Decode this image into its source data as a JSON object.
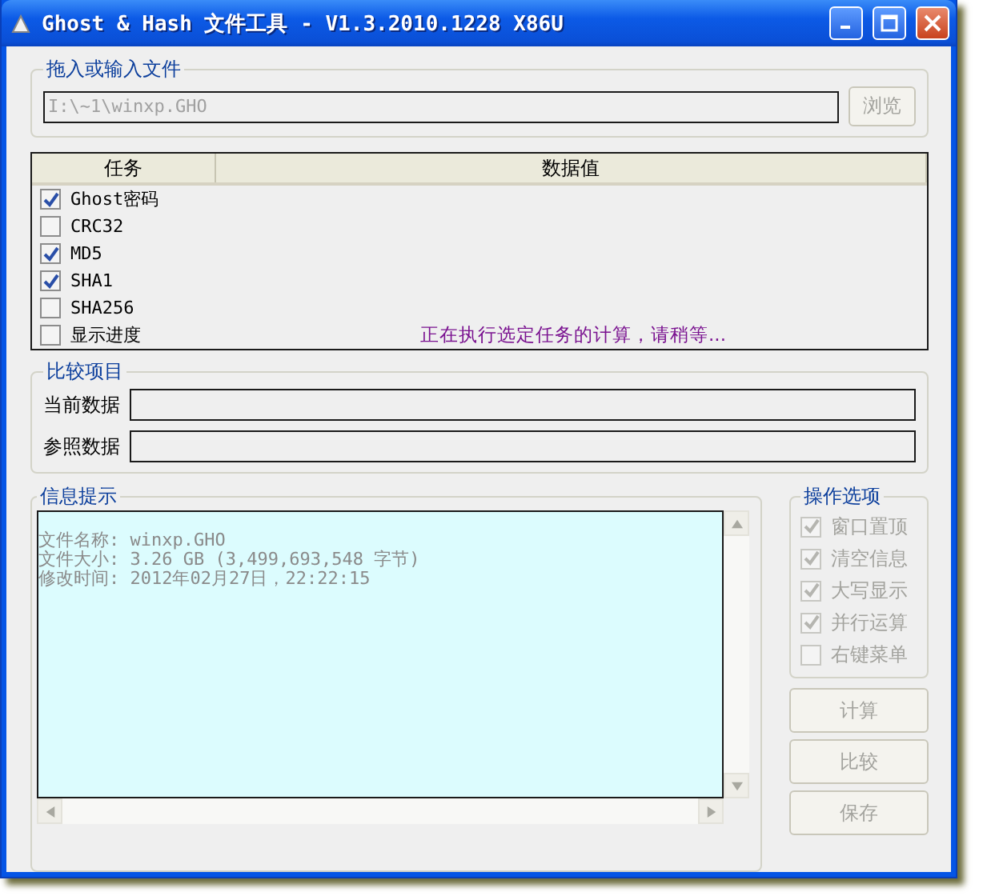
{
  "window": {
    "title": "Ghost & Hash 文件工具 - V1.3.2010.1228 X86U"
  },
  "file_group": {
    "title": "拖入或输入文件",
    "path": "I:\\~1\\winxp.GHO",
    "browse_button": {
      "label": "浏览",
      "disabled": true
    }
  },
  "tasks": {
    "columns": [
      "任务",
      "数据值"
    ],
    "rows": [
      {
        "label": "Ghost密码",
        "checked": true,
        "value": ""
      },
      {
        "label": "CRC32",
        "checked": false,
        "value": ""
      },
      {
        "label": "MD5",
        "checked": true,
        "value": ""
      },
      {
        "label": "SHA1",
        "checked": true,
        "value": ""
      },
      {
        "label": "SHA256",
        "checked": false,
        "value": ""
      },
      {
        "label": "显示进度",
        "checked": false,
        "value": "正在执行选定任务的计算，请稍等..."
      }
    ]
  },
  "compare_group": {
    "title": "比较项目",
    "fields": [
      {
        "label": "当前数据"
      },
      {
        "label": "参照数据"
      }
    ]
  },
  "info_group": {
    "title": "信息提示",
    "lines": [
      "文件名称: winxp.GHO",
      "文件大小: 3.26 GB (3,499,693,548 字节)",
      "修改时间: 2012年02月27日，22:22:15"
    ]
  },
  "options_group": {
    "title": "操作选项",
    "disabled": true,
    "items": [
      {
        "label": "窗口置顶",
        "checked": true
      },
      {
        "label": "清空信息",
        "checked": true
      },
      {
        "label": "大写显示",
        "checked": true
      },
      {
        "label": "并行运算",
        "checked": true
      },
      {
        "label": "右键菜单",
        "checked": false
      }
    ]
  },
  "buttons": [
    {
      "label": "计算",
      "disabled": true
    },
    {
      "label": "比较",
      "disabled": true
    },
    {
      "label": "保存",
      "disabled": true
    }
  ]
}
